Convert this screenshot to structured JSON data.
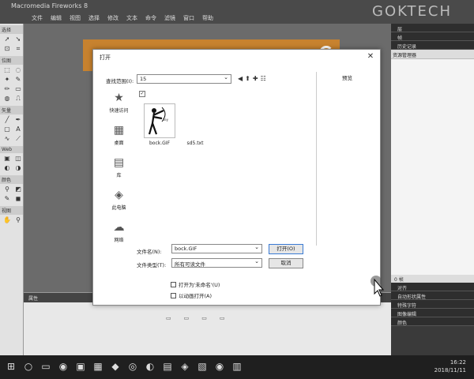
{
  "app": {
    "title": "Macromedia Fireworks 8",
    "watermark": "GOKTECH",
    "menu": [
      "文件",
      "编辑",
      "视图",
      "选择",
      "修改",
      "文本",
      "命令",
      "滤镜",
      "窗口",
      "帮助"
    ]
  },
  "toolbar": {
    "sections": [
      "选择",
      "位图",
      "矢量",
      "Web",
      "颜色",
      "视图"
    ]
  },
  "dialog": {
    "title": "打开",
    "look_in_label": "查找范围(I):",
    "look_in_value": "15",
    "preview_label": "预览",
    "places": [
      {
        "label": "快速访问",
        "icon": "star-icon"
      },
      {
        "label": "桌面",
        "icon": "desktop-icon"
      },
      {
        "label": "库",
        "icon": "library-icon"
      },
      {
        "label": "此电脑",
        "icon": "computer-icon"
      },
      {
        "label": "网络",
        "icon": "network-icon"
      }
    ],
    "files": [
      {
        "name": "bock.GIF",
        "type": "image"
      },
      {
        "name": "sd5.txt",
        "type": "text"
      }
    ],
    "filename_label": "文件名(N):",
    "filename_value": "bock.GIF",
    "filetype_label": "文件类型(T):",
    "filetype_value": "所有可读文件",
    "open_button": "打开(O)",
    "cancel_button": "取消",
    "option1": "打开为'未命名'(U)",
    "option2": "以动画打开(A)"
  },
  "properties": {
    "header": "属性"
  },
  "rpanel": {
    "panels_top": [
      "层",
      "帧",
      "历史记录"
    ],
    "files_tab": "资源管理器",
    "panels_bottom": [
      "对齐",
      "自动形状属性",
      "特殊字符",
      "图像编辑",
      "颜色"
    ],
    "bottom_bar": "0 帧"
  },
  "taskbar": {
    "time": "16:22",
    "date": "2018/11/11"
  }
}
